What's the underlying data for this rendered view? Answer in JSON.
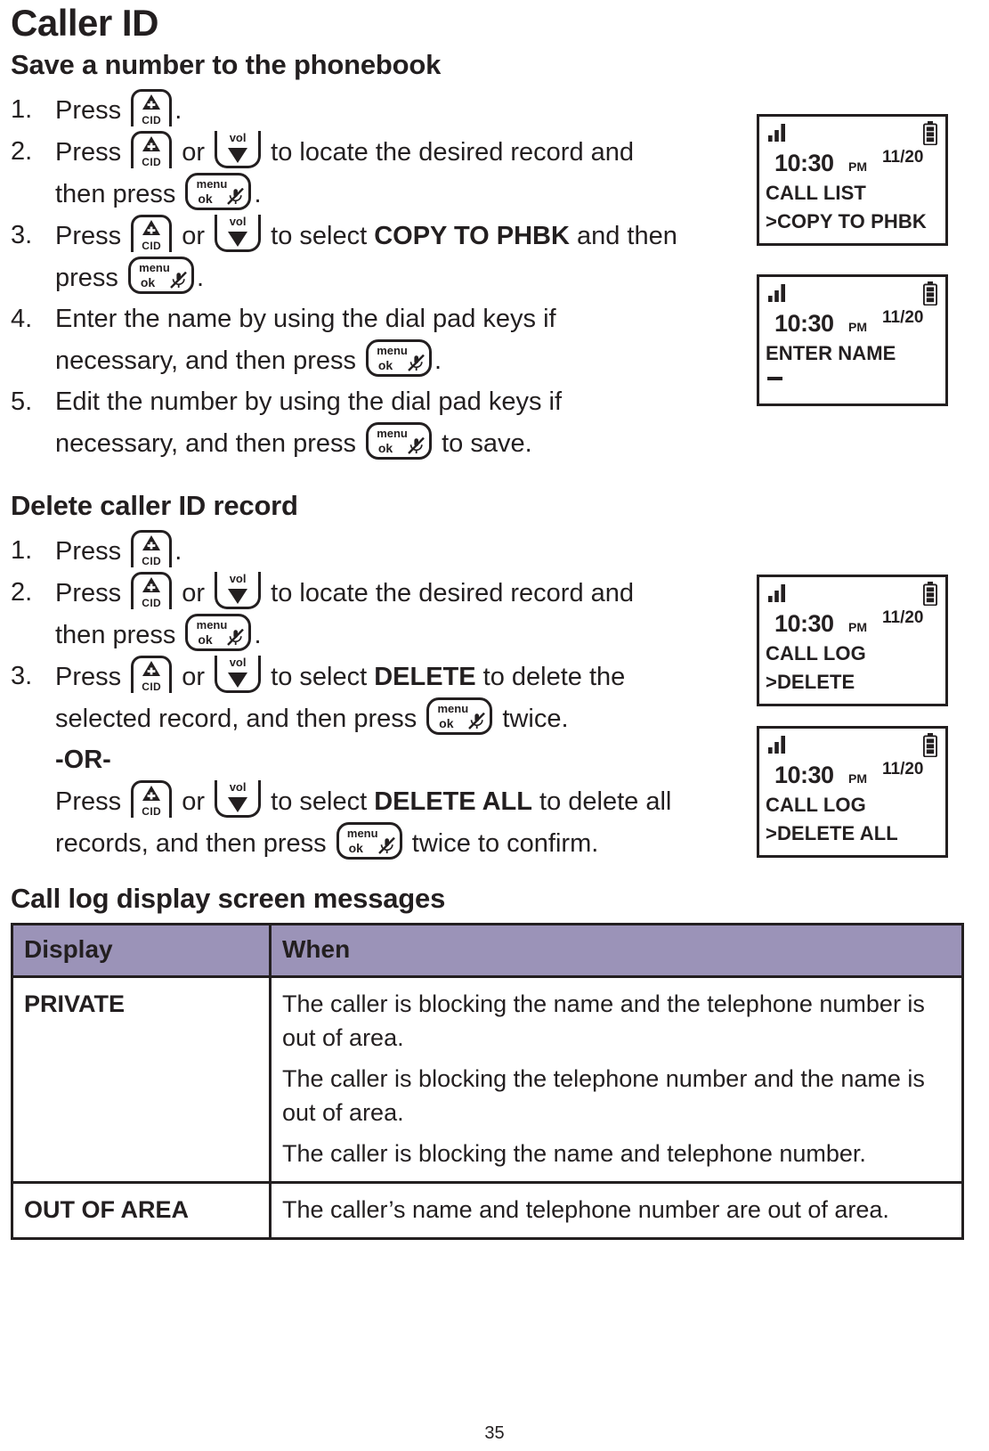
{
  "document": {
    "title": "Caller ID",
    "page_number": "35"
  },
  "sections": [
    {
      "heading": "Save a number to the phonebook",
      "steps": [
        {
          "num": "1.",
          "lines": [
            [
              {
                "t": "text",
                "v": "Press "
              },
              {
                "t": "key",
                "v": "cid"
              },
              {
                "t": "text",
                "v": "."
              }
            ]
          ]
        },
        {
          "num": "2.",
          "lines": [
            [
              {
                "t": "text",
                "v": "Press "
              },
              {
                "t": "key",
                "v": "cid"
              },
              {
                "t": "text",
                "v": " or "
              },
              {
                "t": "key",
                "v": "vol"
              },
              {
                "t": "text",
                "v": " to locate the desired record and"
              }
            ],
            [
              {
                "t": "text",
                "v": "then press "
              },
              {
                "t": "key",
                "v": "menu"
              },
              {
                "t": "text",
                "v": "."
              }
            ]
          ]
        },
        {
          "num": "3.",
          "lines": [
            [
              {
                "t": "text",
                "v": "Press "
              },
              {
                "t": "key",
                "v": "cid"
              },
              {
                "t": "text",
                "v": " or "
              },
              {
                "t": "key",
                "v": "vol"
              },
              {
                "t": "text",
                "v": " to select "
              },
              {
                "t": "bold",
                "v": "COPY TO PHBK"
              },
              {
                "t": "text",
                "v": " and then"
              }
            ],
            [
              {
                "t": "text",
                "v": "press "
              },
              {
                "t": "key",
                "v": "menu"
              },
              {
                "t": "text",
                "v": "."
              }
            ]
          ]
        },
        {
          "num": "4.",
          "lines": [
            [
              {
                "t": "text",
                "v": "Enter the name by using the dial pad keys if"
              }
            ],
            [
              {
                "t": "text",
                "v": "necessary, and then press "
              },
              {
                "t": "key",
                "v": "menu"
              },
              {
                "t": "text",
                "v": "."
              }
            ]
          ]
        },
        {
          "num": "5.",
          "lines": [
            [
              {
                "t": "text",
                "v": "Edit the number by using the dial pad keys if"
              }
            ],
            [
              {
                "t": "text",
                "v": "necessary, and then press "
              },
              {
                "t": "key",
                "v": "menu"
              },
              {
                "t": "text",
                "v": " to save."
              }
            ]
          ]
        }
      ]
    },
    {
      "heading": "Delete caller ID record",
      "steps": [
        {
          "num": "1.",
          "lines": [
            [
              {
                "t": "text",
                "v": "Press "
              },
              {
                "t": "key",
                "v": "cid"
              },
              {
                "t": "text",
                "v": "."
              }
            ]
          ]
        },
        {
          "num": "2.",
          "lines": [
            [
              {
                "t": "text",
                "v": "Press "
              },
              {
                "t": "key",
                "v": "cid"
              },
              {
                "t": "text",
                "v": " or "
              },
              {
                "t": "key",
                "v": "vol"
              },
              {
                "t": "text",
                "v": " to locate the desired record and"
              }
            ],
            [
              {
                "t": "text",
                "v": "then press "
              },
              {
                "t": "key",
                "v": "menu"
              },
              {
                "t": "text",
                "v": "."
              }
            ]
          ]
        },
        {
          "num": "3.",
          "lines": [
            [
              {
                "t": "text",
                "v": "Press "
              },
              {
                "t": "key",
                "v": "cid"
              },
              {
                "t": "text",
                "v": " or "
              },
              {
                "t": "key",
                "v": "vol"
              },
              {
                "t": "text",
                "v": " to select "
              },
              {
                "t": "bold",
                "v": "DELETE"
              },
              {
                "t": "text",
                "v": " to delete the"
              }
            ],
            [
              {
                "t": "text",
                "v": "selected record, and then press "
              },
              {
                "t": "key",
                "v": "menu"
              },
              {
                "t": "text",
                "v": " twice."
              }
            ],
            [
              {
                "t": "boldline",
                "v": "-OR-"
              }
            ],
            [
              {
                "t": "text",
                "v": "Press "
              },
              {
                "t": "key",
                "v": "cid"
              },
              {
                "t": "text",
                "v": " or "
              },
              {
                "t": "key",
                "v": "vol"
              },
              {
                "t": "text",
                "v": " to select "
              },
              {
                "t": "bold",
                "v": "DELETE ALL"
              },
              {
                "t": "text",
                "v": " to delete all"
              }
            ],
            [
              {
                "t": "text",
                "v": "records, and then press "
              },
              {
                "t": "key",
                "v": "menu"
              },
              {
                "t": "text",
                "v": " twice to confirm."
              }
            ]
          ]
        }
      ]
    }
  ],
  "keys": {
    "cid": {
      "icon": "cid-key-icon",
      "label": "CID",
      "glyph": "triangle-plus-icon"
    },
    "vol": {
      "icon": "vol-down-key-icon",
      "label": "vol",
      "glyph": "triangle-down-icon"
    },
    "menu": {
      "icon": "menu-ok-key-icon",
      "line1": "menu",
      "line2": "ok",
      "glyph": "mute-mic-icon"
    }
  },
  "lcd_screens": [
    {
      "id": "lcd-1",
      "signal_icon": "signal-bars-icon",
      "battery_icon": "battery-full-icon",
      "time": "10:30",
      "ampm": "PM",
      "date": "11/20",
      "line1": "CALL LIST",
      "line2": ">COPY TO PHBK",
      "cursor": false
    },
    {
      "id": "lcd-2",
      "signal_icon": "signal-bars-icon",
      "battery_icon": "battery-full-icon",
      "time": "10:30",
      "ampm": "PM",
      "date": "11/20",
      "line1": "ENTER NAME",
      "line2": "",
      "cursor": true
    },
    {
      "id": "lcd-3",
      "signal_icon": "signal-bars-icon",
      "battery_icon": "battery-full-icon",
      "time": "10:30",
      "ampm": "PM",
      "date": "11/20",
      "line1": "CALL LOG",
      "line2": ">DELETE",
      "cursor": false
    },
    {
      "id": "lcd-4",
      "signal_icon": "signal-bars-icon",
      "battery_icon": "battery-full-icon",
      "time": "10:30",
      "ampm": "PM",
      "date": "11/20",
      "line1": "CALL LOG",
      "line2": ">DELETE ALL",
      "cursor": false
    }
  ],
  "table": {
    "heading": "Call log display screen messages",
    "header_bg": "#9b93b8",
    "columns": [
      "Display",
      "When"
    ],
    "rows": [
      {
        "display": "PRIVATE",
        "when": [
          "The caller is blocking the name and the telephone number is out of area.",
          "The caller is blocking the telephone number and the name is out of area.",
          "The caller is blocking the name and telephone number."
        ]
      },
      {
        "display": "OUT OF AREA",
        "when": [
          "The caller’s name and telephone number are out of area."
        ]
      }
    ]
  }
}
